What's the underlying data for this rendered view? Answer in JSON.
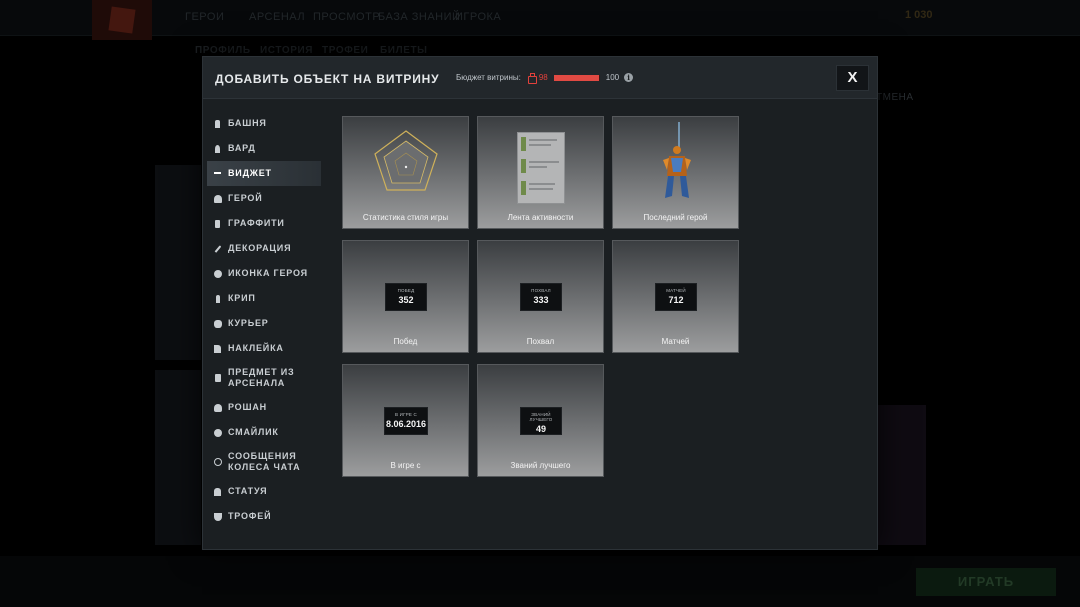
{
  "background": {
    "nav": [
      "ГЕРОИ",
      "АРСЕНАЛ",
      "ПРОСМОТР",
      "БАЗА ЗНАНИЙ",
      "ИГРОКА"
    ],
    "gold": "1 030",
    "subnav": [
      "ПРОФИЛЬ",
      "ИСТОРИЯ",
      "ТРОФЕИ",
      "БИЛЕТЫ"
    ],
    "cancel_label": "ТМЕНА",
    "play_label": "ИГРАТЬ"
  },
  "modal": {
    "title": "ДОБАВИТЬ ОБЪЕКТ НА ВИТРИНУ",
    "budget": {
      "label": "Бюджет витрины:",
      "used": "98",
      "max": "100",
      "fill_fraction": 0.98,
      "bar_color": "#e14a43"
    },
    "close_label": "X"
  },
  "sidebar": {
    "items": [
      {
        "label": "БАШНЯ",
        "icon": "tower-icon"
      },
      {
        "label": "ВАРД",
        "icon": "ward-icon"
      },
      {
        "label": "ВИДЖЕТ",
        "icon": "widget-icon",
        "active": true
      },
      {
        "label": "ГЕРОЙ",
        "icon": "hero-helmet-icon"
      },
      {
        "label": "ГРАФФИТИ",
        "icon": "spray-can-icon"
      },
      {
        "label": "ДЕКОРАЦИЯ",
        "icon": "wand-icon"
      },
      {
        "label": "ИКОНКА ГЕРОЯ",
        "icon": "hero-face-icon"
      },
      {
        "label": "КРИП",
        "icon": "creep-icon"
      },
      {
        "label": "КУРЬЕР",
        "icon": "courier-icon"
      },
      {
        "label": "НАКЛЕЙКА",
        "icon": "sticker-icon"
      },
      {
        "label": "ПРЕДМЕТ ИЗ АРСЕНАЛА",
        "icon": "armory-icon"
      },
      {
        "label": "РОШАН",
        "icon": "roshan-icon"
      },
      {
        "label": "СМАЙЛИК",
        "icon": "emoticon-icon"
      },
      {
        "label": "СООБЩЕНИЯ КОЛЕСА ЧАТА",
        "icon": "chat-wheel-icon"
      },
      {
        "label": "СТАТУЯ",
        "icon": "statue-icon"
      },
      {
        "label": "ТРОФЕЙ",
        "icon": "trophy-icon"
      }
    ]
  },
  "widgets": {
    "play_style": {
      "label": "Статистика стиля игры"
    },
    "activity_feed": {
      "label": "Лента активности"
    },
    "last_hero": {
      "label": "Последний герой"
    },
    "wins": {
      "label": "Побед",
      "caption": "ПОБЕД",
      "value": "352"
    },
    "commends": {
      "label": "Похвал",
      "caption": "ПОХВАЛ",
      "value": "333"
    },
    "matches": {
      "label": "Матчей",
      "caption": "МАТЧЕЙ",
      "value": "712"
    },
    "playing_since": {
      "label": "В игре с",
      "caption": "В ИГРЕ С",
      "value": "8.06.2016"
    },
    "mvp": {
      "label": "Званий лучшего",
      "caption": "ЗВАНИЙ ЛУЧШЕГО",
      "value": "49"
    }
  }
}
